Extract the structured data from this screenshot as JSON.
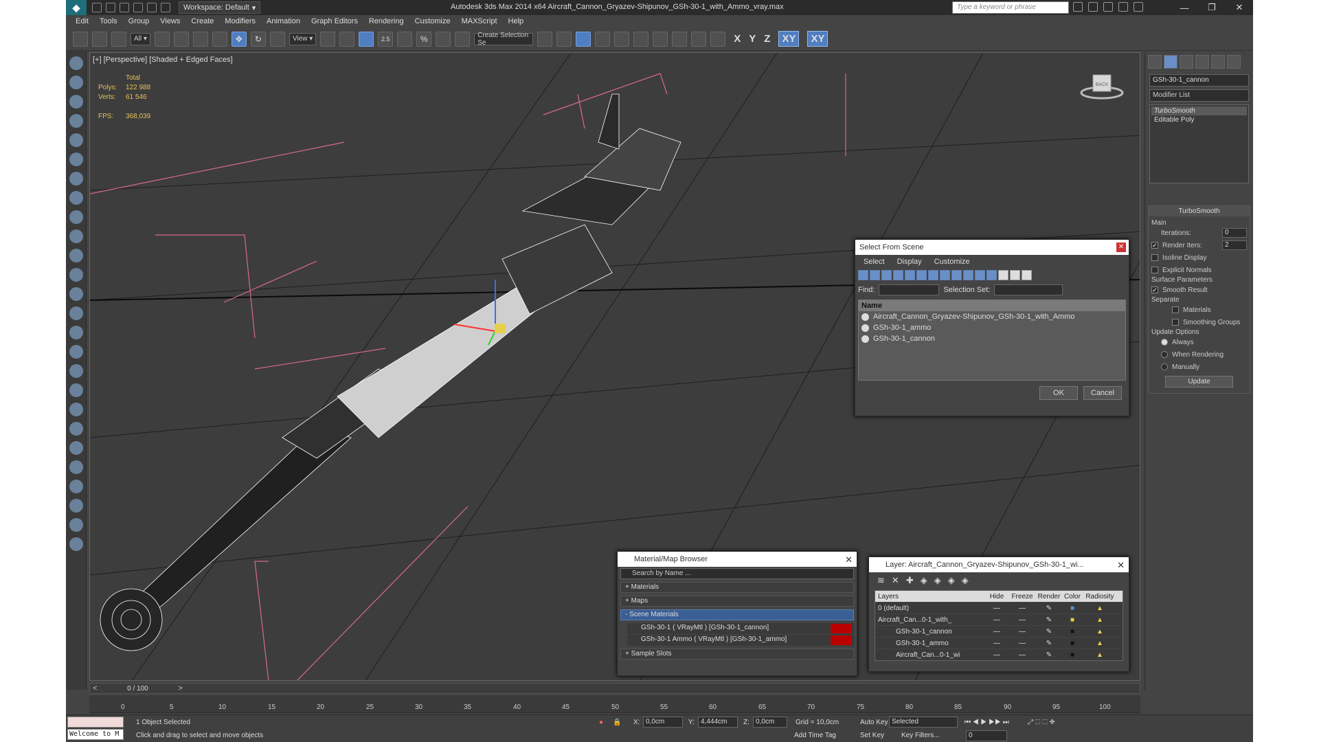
{
  "titlebar": {
    "workspace": "Workspace: Default",
    "title": "Autodesk 3ds Max  2014 x64     Aircraft_Cannon_Gryazev-Shipunov_GSh-30-1_with_Ammo_vray.max",
    "search_placeholder": "Type a keyword or phrase"
  },
  "menu": [
    "Edit",
    "Tools",
    "Group",
    "Views",
    "Create",
    "Modifiers",
    "Animation",
    "Graph Editors",
    "Rendering",
    "Customize",
    "MAXScript",
    "Help"
  ],
  "toolbar": {
    "filter": "All",
    "refcoord": "View",
    "snap": "2.5",
    "selset_placeholder": "Create Selection Se",
    "axes": [
      "X",
      "Y",
      "Z",
      "XY",
      "XY"
    ]
  },
  "viewport": {
    "label": "[+] [Perspective] [Shaded + Edged Faces]",
    "stats_total": "Total",
    "polys_label": "Polys:",
    "polys": "122 988",
    "verts_label": "Verts:",
    "verts": "61 546",
    "fps_label": "FPS:",
    "fps": "368,039",
    "viewcube_label": "BACK"
  },
  "cmdpanel": {
    "object_name": "GSh-30-1_cannon",
    "modifier_list": "Modifier List",
    "stack": [
      "TurboSmooth",
      "Editable Poly"
    ],
    "turbosmooth_header": "TurboSmooth",
    "main": "Main",
    "iterations_label": "Iterations:",
    "iterations": "0",
    "render_iters_label": "Render Iters:",
    "render_iters": "2",
    "isoline": "Isoline Display",
    "explicit_normals": "Explicit Normals",
    "surface_params": "Surface Parameters",
    "smooth_result": "Smooth Result",
    "separate": "Separate",
    "materials": "Materials",
    "smoothing_groups": "Smoothing Groups",
    "update_options": "Update Options",
    "always": "Always",
    "when_rendering": "When Rendering",
    "manually": "Manually",
    "update_btn": "Update"
  },
  "select_dialog": {
    "title": "Select From Scene",
    "menu": [
      "Select",
      "Display",
      "Customize"
    ],
    "find_label": "Find:",
    "selset_label": "Selection Set:",
    "name_header": "Name",
    "items": [
      "Aircraft_Cannon_Gryazev-Shipunov_GSh-30-1_with_Ammo",
      "GSh-30-1_ammo",
      "GSh-30-1_cannon"
    ],
    "ok": "OK",
    "cancel": "Cancel"
  },
  "material_browser": {
    "title": "Material/Map Browser",
    "search": "Search by Name ...",
    "materials": "+ Materials",
    "maps": "+ Maps",
    "scene_materials": "- Scene Materials",
    "items": [
      "GSh-30-1  ( VRayMtl ) [GSh-30-1_cannon]",
      "GSh-30-1 Ammo  ( VRayMtl ) [GSh-30-1_ammo]"
    ],
    "sample_slots": "+ Sample Slots"
  },
  "layer_dialog": {
    "title": "Layer: Aircraft_Cannon_Gryazev-Shipunov_GSh-30-1_wi...",
    "cols": [
      "Layers",
      "Hide",
      "Freeze",
      "Render",
      "Color",
      "Radiosity"
    ],
    "rows": [
      "0 (default)",
      "Aircraft_Can...0-1_with_",
      "GSh-30-1_cannon",
      "GSh-30-1_ammo",
      "Aircraft_Can...0-1_wi"
    ]
  },
  "timeslider": {
    "label": "0 / 100",
    "ticks": [
      "0",
      "5",
      "10",
      "15",
      "20",
      "25",
      "30",
      "35",
      "40",
      "45",
      "50",
      "55",
      "60",
      "65",
      "70",
      "75",
      "80",
      "85",
      "90",
      "95",
      "100"
    ]
  },
  "status": {
    "maxscript": "Welcome to M",
    "selected": "1 Object Selected",
    "prompt": "Click and drag to select and move objects",
    "x_label": "X:",
    "x": "0,0cm",
    "y_label": "Y:",
    "y": "4,444cm",
    "z_label": "Z:",
    "z": "0,0cm",
    "grid": "Grid = 10,0cm",
    "add_time_tag": "Add Time Tag",
    "auto_key": "Auto Key",
    "set_key": "Set Key",
    "selected_dropdown": "Selected",
    "key_filters": "Key Filters...",
    "frame": "0"
  },
  "colors": {
    "accent": "#4f7ec1",
    "wire": "#ffffff",
    "stats": "#e6c15a",
    "bbox": "#d96a8a"
  }
}
